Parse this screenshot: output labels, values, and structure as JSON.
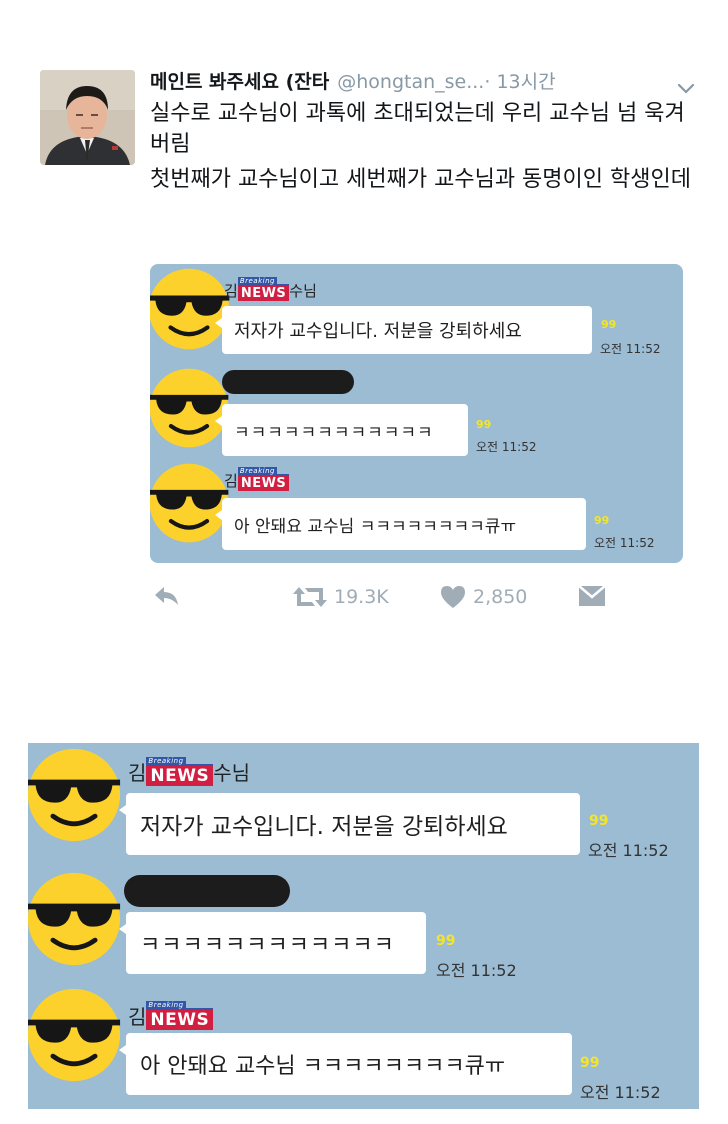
{
  "tweet": {
    "display_name": "메인트 봐주세요 (잔타",
    "handle": "@hongtan_se...",
    "time": "· 13시간",
    "text_lines": [
      "실수로 교수님이 과톡에 초대되었는데 우리 교수님 넘 욱겨버림",
      "첫번째가 교수님이고 세번째가 교수님과 동명이인 학생인데"
    ],
    "retweets": "19.3K",
    "likes": "2,850"
  },
  "chat": {
    "sender1_prefix": "김",
    "sender1_suffix": "수님",
    "sender3_prefix": "김",
    "news_label": "NEWS",
    "breaking_label": "Breaking",
    "messages": [
      {
        "text": "저자가 교수입니다. 저분을 강퇴하세요",
        "unread": "99",
        "time": "오전 11:52"
      },
      {
        "text": "ㅋㅋㅋㅋㅋㅋㅋㅋㅋㅋㅋㅋ",
        "unread": "99",
        "time": "오전 11:52"
      },
      {
        "text": "아 안돼요 교수님 ㅋㅋㅋㅋㅋㅋㅋㅋ큐ㅠ",
        "unread": "99",
        "time": "오전 11:52"
      }
    ]
  },
  "icons": {
    "avatar": "profile-avatar",
    "chevron": "chevron-down-icon",
    "reply": "reply-icon",
    "retweet": "retweet-icon",
    "like": "heart-icon",
    "dm": "direct-message-icon",
    "face": "sunglasses-face-icon"
  },
  "colors": {
    "chat_background": "#9bbcd3",
    "unread_count": "#f4e52a",
    "action_gray": "#a0acb6",
    "news_red": "#d21f41"
  }
}
